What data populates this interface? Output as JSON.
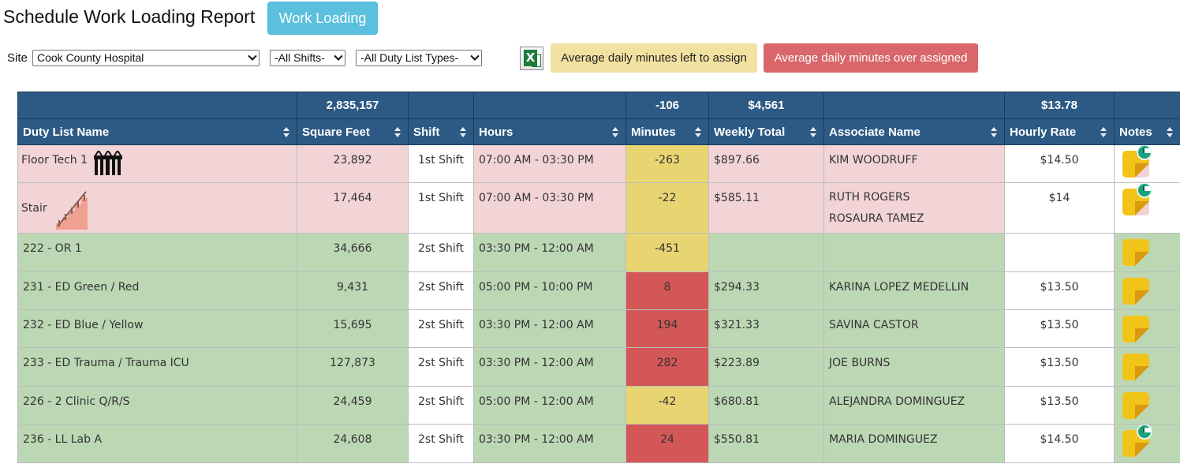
{
  "header": {
    "title": "Schedule Work Loading Report",
    "work_loading_button": "Work Loading"
  },
  "filters": {
    "site_label": "Site",
    "site_value": "Cook County Hospital",
    "shift_value": "-All Shifts-",
    "duty_type_value": "-All Duty List Types-",
    "excel_icon": "excel-export-icon"
  },
  "legend": {
    "left_to_assign": "Average daily minutes left to assign",
    "over_assigned": "Average daily minutes over assigned",
    "left_to_assign_color": "#f2e2a2",
    "over_assigned_color": "#d9666a"
  },
  "table": {
    "totals": {
      "square_feet": "2,835,157",
      "minutes": "-106",
      "weekly_total": "$4,561",
      "hourly_rate": "$13.78"
    },
    "columns": [
      "Duty List Name",
      "Square Feet",
      "Shift",
      "Hours",
      "Minutes",
      "Weekly Total",
      "Associate Name",
      "Hourly Rate",
      "Notes"
    ],
    "rows": [
      {
        "name": "Floor Tech 1",
        "sqft": "23,892",
        "shift": "1st Shift",
        "hours": "07:00 AM - 03:30 PM",
        "minutes": "-263",
        "weekly": "$897.66",
        "associates": [
          "KIM WOODRUFF"
        ],
        "rate": "$14.50",
        "note_flag": true
      },
      {
        "name": "Stair",
        "sqft": "17,464",
        "shift": "1st Shift",
        "hours": "07:00 AM - 03:30 PM",
        "minutes": "-22",
        "weekly": "$585.11",
        "associates": [
          "RUTH ROGERS",
          "ROSAURA TAMEZ"
        ],
        "rate": "$14",
        "note_flag": true
      },
      {
        "name": "222 - OR 1",
        "sqft": "34,666",
        "shift": "2st Shift",
        "hours": "03:30 PM - 12:00 AM",
        "minutes": "-451",
        "weekly": "",
        "associates": [
          ""
        ],
        "rate": "",
        "note_flag": false
      },
      {
        "name": "231 - ED Green / Red",
        "sqft": "9,431",
        "shift": "2st Shift",
        "hours": "05:00 PM - 10:00 PM",
        "minutes": "8",
        "weekly": "$294.33",
        "associates": [
          "KARINA LOPEZ MEDELLIN"
        ],
        "rate": "$13.50",
        "note_flag": false
      },
      {
        "name": "232 - ED Blue / Yellow",
        "sqft": "15,695",
        "shift": "2st Shift",
        "hours": "03:30 PM - 12:00 AM",
        "minutes": "194",
        "weekly": "$321.33",
        "associates": [
          "SAVINA CASTOR"
        ],
        "rate": "$13.50",
        "note_flag": false
      },
      {
        "name": "233 - ED Trauma / Trauma ICU",
        "sqft": "127,873",
        "shift": "2st Shift",
        "hours": "03:30 PM - 12:00 AM",
        "minutes": "282",
        "weekly": "$223.89",
        "associates": [
          "JOE BURNS"
        ],
        "rate": "$13.50",
        "note_flag": false
      },
      {
        "name": "226 - 2 Clinic Q/R/S",
        "sqft": "24,459",
        "shift": "2st Shift",
        "hours": "05:00 PM - 12:00 AM",
        "minutes": "-42",
        "weekly": "$680.81",
        "associates": [
          "ALEJANDRA DOMINGUEZ"
        ],
        "rate": "$13.50",
        "note_flag": false
      },
      {
        "name": "236 - LL Lab A",
        "sqft": "24,608",
        "shift": "2st Shift",
        "hours": "03:30 PM - 12:00 AM",
        "minutes": "24",
        "weekly": "$550.81",
        "associates": [
          "MARIA DOMINGUEZ"
        ],
        "rate": "$14.50",
        "note_flag": true
      }
    ]
  }
}
